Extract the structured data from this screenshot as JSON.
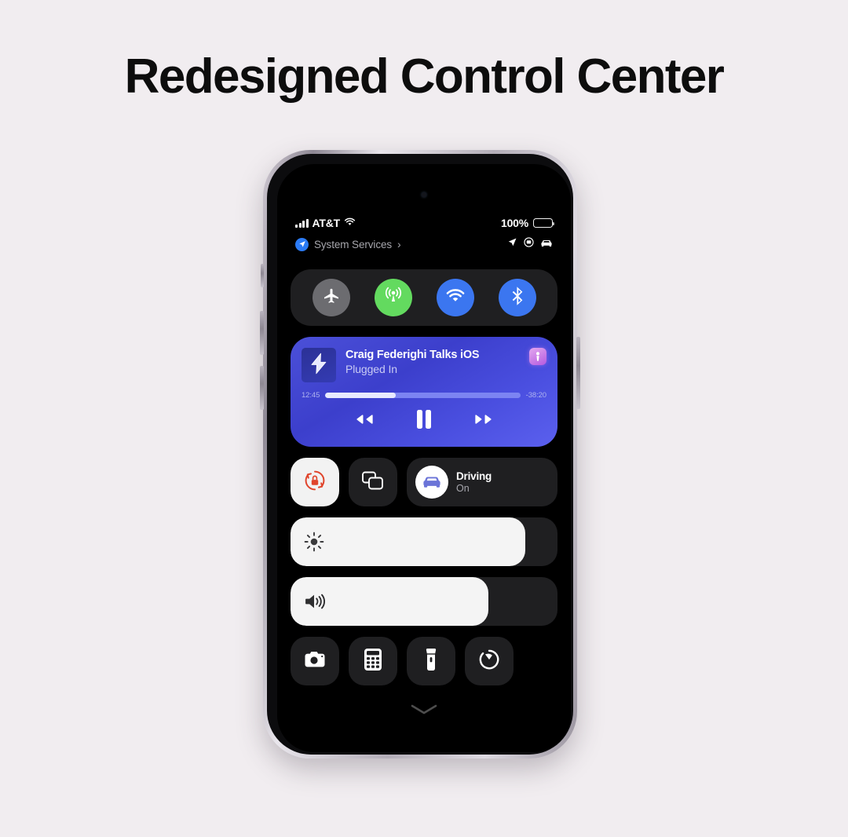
{
  "page": {
    "headline": "Redesigned Control Center",
    "background_color": "#f1edf0",
    "title_color": "#0d0d0d"
  },
  "status_bar": {
    "signal_icon": "cellular-signal-icon",
    "carrier": "AT&T",
    "wifi_icon": "wifi-icon",
    "battery_percent": "100%",
    "battery_icon": "battery-full-icon"
  },
  "system_services": {
    "location_icon": "location-arrow-badge-icon",
    "label": "System Services",
    "chevron": "›",
    "right_icons": [
      "location-arrow-icon",
      "screen-record-icon",
      "car-icon"
    ]
  },
  "connectivity": {
    "items": [
      {
        "name": "airplane-mode",
        "icon": "airplane-icon",
        "state": "off",
        "color": "#6c6c70"
      },
      {
        "name": "cellular-data",
        "icon": "cellular-broadcast-icon",
        "state": "on",
        "color": "#63da5f"
      },
      {
        "name": "wifi",
        "icon": "wifi-icon",
        "state": "on",
        "color": "#3b76f0"
      },
      {
        "name": "bluetooth",
        "icon": "bluetooth-icon",
        "state": "on",
        "color": "#3b76f0"
      }
    ]
  },
  "media_player": {
    "artwork_icon": "lightning-bolt-icon",
    "title": "Craig Federighi Talks iOS",
    "subtitle": "Plugged In",
    "app_icon": "podcasts-app-icon",
    "elapsed_time": "12:45",
    "remaining_time": "-38:20",
    "progress_percent": 36,
    "controls": {
      "rewind": "rewind-icon",
      "play_pause": "pause-icon",
      "forward": "fast-forward-icon"
    },
    "accent_color": "#4b50d8"
  },
  "toggles": {
    "rotation_lock": {
      "icon": "rotation-lock-icon",
      "state": "on",
      "bg": "#f2f2f2",
      "fg": "#e0452c"
    },
    "screen_mirroring": {
      "icon": "screen-mirroring-icon",
      "state": "off"
    },
    "focus": {
      "icon": "car-focus-icon",
      "title": "Driving",
      "state": "On"
    }
  },
  "sliders": [
    {
      "name": "brightness-slider",
      "icon": "brightness-sun-icon",
      "value": 88
    },
    {
      "name": "volume-slider",
      "icon": "speaker-wave-icon",
      "value": 74
    }
  ],
  "utilities": [
    {
      "name": "camera-button",
      "icon": "camera-icon"
    },
    {
      "name": "calculator-button",
      "icon": "calculator-icon"
    },
    {
      "name": "flashlight-button",
      "icon": "flashlight-icon"
    },
    {
      "name": "timer-button",
      "icon": "timer-icon"
    }
  ],
  "dismiss": {
    "icon": "chevron-down-icon"
  }
}
